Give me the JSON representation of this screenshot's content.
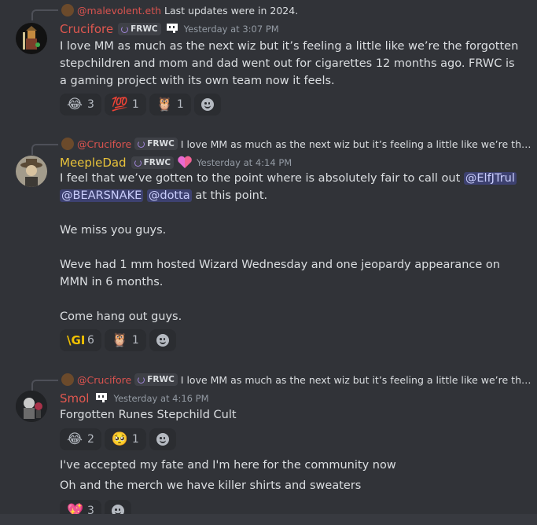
{
  "messages": [
    {
      "reply": {
        "author": "@malevolent.eth",
        "snippet": "Last updates were in 2024."
      },
      "author": "Crucifore",
      "author_color": "#d9534f",
      "tag": "FRWC",
      "timestamp": "Yesterday at 3:07 PM",
      "paragraphs": [
        "I love MM as much as the next wiz but it’s feeling a little like we’re the forgotten stepchildren and mom and dad went out for cigarettes 12 months ago. FRWC is a gaming project with its own team now it feels."
      ],
      "reactions": [
        {
          "emoji": "😂",
          "count": "3"
        },
        {
          "emoji": "💯",
          "count": "1"
        },
        {
          "emoji": "🦉",
          "count": "1"
        }
      ]
    },
    {
      "reply": {
        "author": "@Crucifore",
        "tag": "FRWC",
        "snippet": "I love MM as much as the next wiz but it’s feeling a little like we’re the for..."
      },
      "author": "MeepleDad",
      "author_color": "#e8c23a",
      "tag": "FRWC",
      "timestamp": "Yesterday at 4:14 PM",
      "line1": "I feel that we’ve gotten to the point where is absolutely fair to call out",
      "mentions": [
        "@ElfJTrul",
        "@BEARSNAKE",
        "@dotta"
      ],
      "line2_tail": "at this point.",
      "paragraphs": [
        "We miss you guys.",
        "Weve had 1 mm hosted Wizard Wednesday and one jeopardy appearance on MMN in 6 months.",
        "Come hang out guys."
      ],
      "reactions": [
        {
          "emoji": "\\GI",
          "count": "6"
        },
        {
          "emoji": "🦉",
          "count": "1"
        }
      ]
    },
    {
      "reply": {
        "author": "@Crucifore",
        "tag": "FRWC",
        "snippet": "I love MM as much as the next wiz but it’s feeling a little like we’re the for..."
      },
      "author": "Smol",
      "author_color": "#d9534f",
      "timestamp": "Yesterday at 4:16 PM",
      "paragraphs": [
        "Forgotten Runes Stepchild Cult"
      ],
      "reactions": [
        {
          "emoji": "😂",
          "count": "2"
        },
        {
          "emoji": "🥺",
          "count": "1"
        }
      ],
      "followups": [
        "I've accepted my fate and I'm here for the community now",
        "Oh and the merch we have killer shirts and sweaters"
      ],
      "followup_reactions": [
        {
          "emoji": "💖",
          "count": "3"
        }
      ]
    }
  ],
  "colors": {
    "background": "#313338",
    "mention_bg": "#3c4270",
    "reaction_bg": "#2b2d31"
  }
}
